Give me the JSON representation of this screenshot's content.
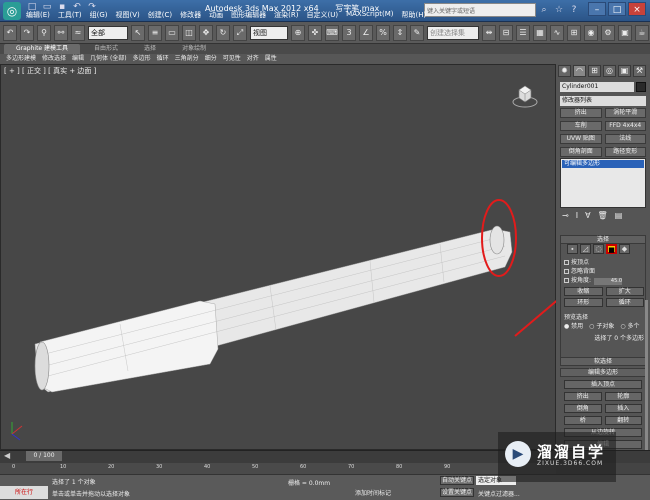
{
  "app": {
    "title": "Autodesk 3ds Max  2012 x64",
    "file_name": "写字笔.max",
    "search_placeholder": "键入关键字或短语",
    "menu": [
      "编辑(E)",
      "工具(T)",
      "组(G)",
      "视图(V)",
      "创建(C)",
      "修改器",
      "动画",
      "图形编辑器",
      "渲染(R)",
      "自定义(U)",
      "MAXScript(M)",
      "帮助(H)"
    ]
  },
  "toolbar": {
    "filter_value": "全部",
    "refcoord_value": "视图",
    "named_sel_placeholder": "创建选择集",
    "counter": "3"
  },
  "ribbon": {
    "tabs": [
      "Graphite 建模工具",
      "自由形式",
      "选择",
      "对象绘制"
    ],
    "items": [
      "多边形建模",
      "修改选择",
      "编辑",
      "几何体 (全部)",
      "多边形",
      "循环",
      "三角剖分",
      "细分",
      "可见性",
      "对齐",
      "属性"
    ]
  },
  "viewport": {
    "label": "[ + ] [ 正交 ] [ 真实 + 边面 ]"
  },
  "command_panel": {
    "tab_icons": [
      "create-icon",
      "modify-icon",
      "hierarchy-icon",
      "motion-icon",
      "display-icon",
      "utilities-icon"
    ],
    "object_name": "Cylinder001",
    "object_color": "#2a2a2a",
    "modifier_list": "修改器列表",
    "modifier_buttons": [
      "挤出",
      "涡轮平滑",
      "车削",
      "FFD 4x4x4",
      "UVW 贴图",
      "法线",
      "倒角剖面",
      "路径变形"
    ],
    "stack_item": "可编辑多边形",
    "selection": {
      "title": "选择",
      "by_vertex": "按顶点",
      "ignore_backfacing": "忽略背面",
      "by_angle": "按角度:",
      "angle_value": "45.0",
      "shrink": "收缩",
      "grow": "扩大",
      "ring": "环形",
      "loop": "循环",
      "preview_title": "预览选择",
      "preview_options": [
        "禁用",
        "子对象",
        "多个"
      ],
      "status": "选择了 0 个多边形"
    },
    "soft_selection": "软选择",
    "edit_polygons": {
      "title": "编辑多边形",
      "insert_vertex": "插入顶点",
      "extrude": "挤出",
      "outline": "轮廓",
      "bevel": "倒角",
      "inset": "插入",
      "bridge": "桥",
      "flip": "翻转",
      "hinge": "从边旋转",
      "edit": "编辑"
    }
  },
  "timeline": {
    "frame": "0 / 100",
    "ticks": [
      "0",
      "10",
      "20",
      "30",
      "40",
      "50",
      "60",
      "70",
      "80",
      "90"
    ]
  },
  "status": {
    "listener": "所在行",
    "line1": "选择了 1 个对象",
    "line2": "单击或单击并拖动以选择对象",
    "grid": "栅格 = 0.0mm",
    "add_time_tag": "添加时间标记",
    "auto_key": "自动关键点",
    "selected_object": "选定对象",
    "set_key": "设置关键点",
    "key_filters": "关键点过滤器..."
  },
  "watermark": {
    "title": "溜溜自学",
    "url": "ZIXUE.3D66.COM"
  }
}
